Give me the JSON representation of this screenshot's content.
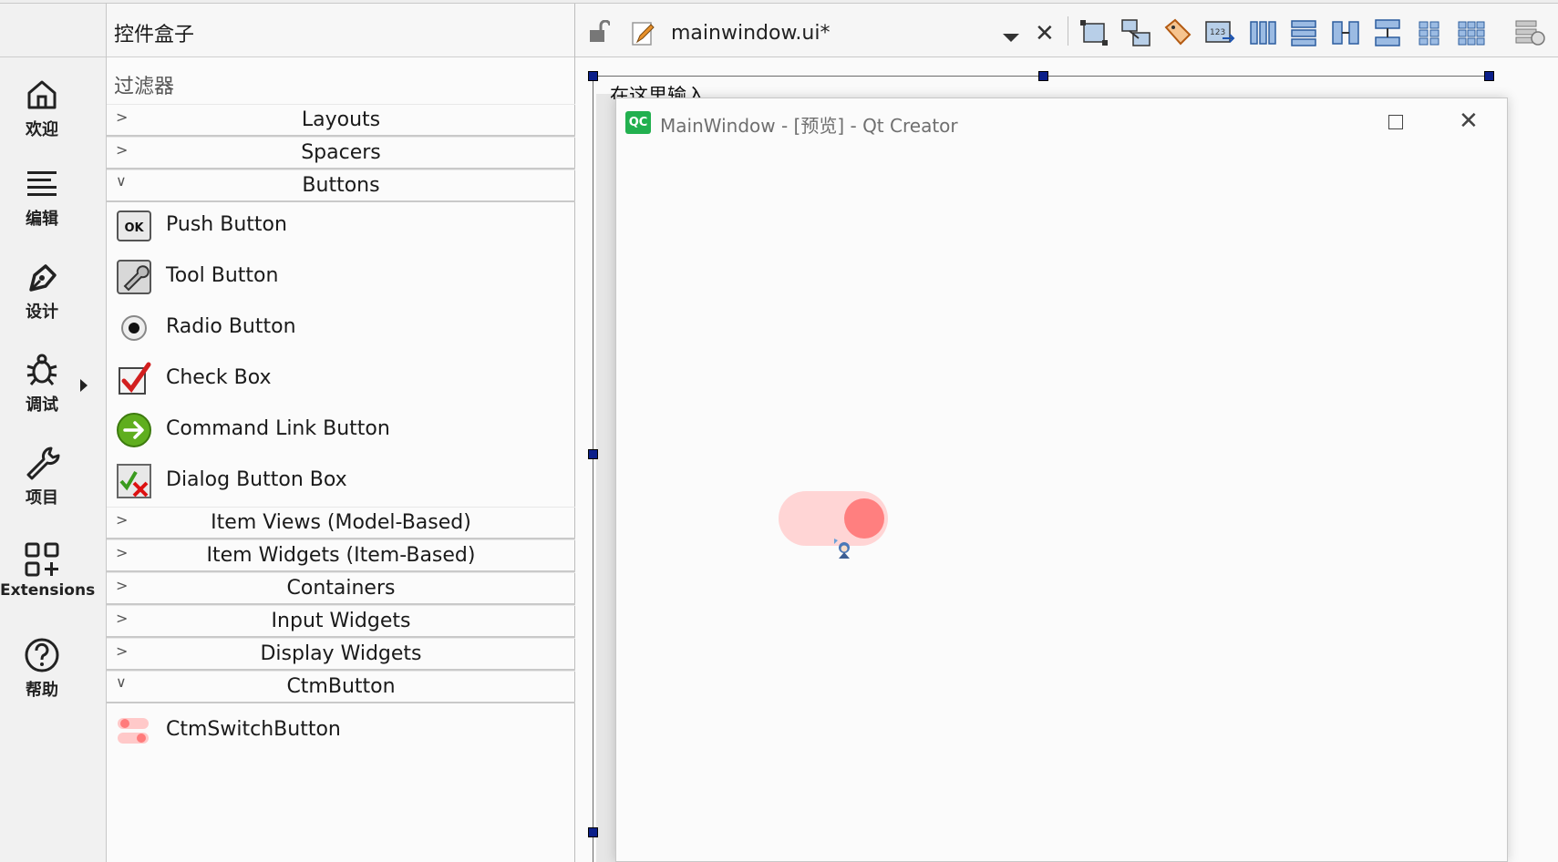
{
  "modes": [
    {
      "key": "welcome",
      "label": "欢迎",
      "icon": "home-icon"
    },
    {
      "key": "edit",
      "label": "编辑",
      "icon": "edit-lines-icon"
    },
    {
      "key": "design",
      "label": "设计",
      "icon": "pen-nib-icon"
    },
    {
      "key": "debug",
      "label": "调试",
      "icon": "bug-icon"
    },
    {
      "key": "project",
      "label": "项目",
      "icon": "wrench-icon"
    },
    {
      "key": "extensions",
      "label": "Extensions",
      "icon": "extensions-grid-icon"
    },
    {
      "key": "help",
      "label": "帮助",
      "icon": "help-circle-icon"
    }
  ],
  "widgetbox": {
    "title": "控件盒子",
    "filter_placeholder": "过滤器",
    "categories": {
      "layouts": "Layouts",
      "spacers": "Spacers",
      "buttons": "Buttons",
      "item_views": "Item Views (Model-Based)",
      "item_widgets": "Item Widgets (Item-Based)",
      "containers": "Containers",
      "input_widgets": "Input Widgets",
      "display_widgets": "Display Widgets",
      "ctmbutton": "CtmButton"
    },
    "button_items": [
      {
        "label": "Push Button",
        "icon": "push-button-icon"
      },
      {
        "label": "Tool Button",
        "icon": "tool-button-icon"
      },
      {
        "label": "Radio Button",
        "icon": "radio-button-icon"
      },
      {
        "label": "Check Box",
        "icon": "check-box-icon"
      },
      {
        "label": "Command Link Button",
        "icon": "command-link-icon"
      },
      {
        "label": "Dialog Button Box",
        "icon": "dialog-button-box-icon"
      }
    ],
    "custom_items": [
      {
        "label": "CtmSwitchButton",
        "icon": "switch-button-icon"
      }
    ]
  },
  "designer": {
    "file_name": "mainwindow.ui*",
    "canvas_label": "在这里输入",
    "accent": "#0b1f8a"
  },
  "preview": {
    "title": "MainWindow - [预览] - Qt Creator",
    "logo_text": "QC",
    "switch_track_color": "#ffd5d5",
    "switch_knob_color": "#ff7f7f"
  }
}
